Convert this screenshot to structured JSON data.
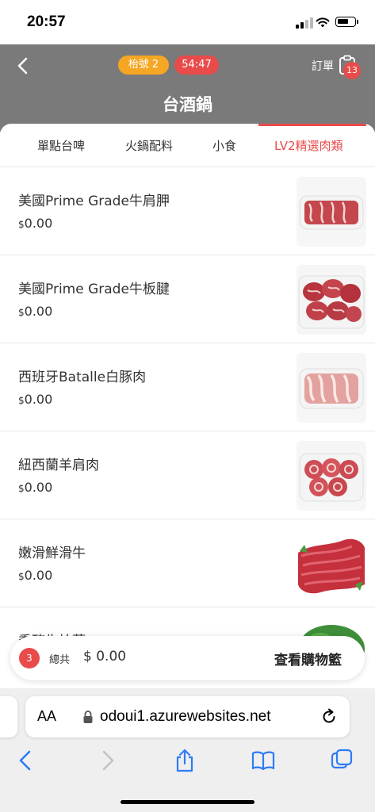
{
  "status_bar": {
    "time": "20:57"
  },
  "header": {
    "table_badge": "枱號 2",
    "timer_badge": "54:47",
    "order_label": "訂單",
    "order_count": "13",
    "store_title": "台酒鍋"
  },
  "tabs": [
    {
      "label": "單點台啤",
      "active": false
    },
    {
      "label": "火鍋配料",
      "active": false
    },
    {
      "label": "小食",
      "active": false
    },
    {
      "label": "LV2精選肉類",
      "active": true
    }
  ],
  "items": [
    {
      "name": "美國Prime Grade牛肩胛",
      "currency": "$",
      "price": "0.00",
      "image": "sliced-beef-image"
    },
    {
      "name": "美國Prime Grade牛板腱",
      "currency": "$",
      "price": "0.00",
      "image": "beef-rolls-image"
    },
    {
      "name": "西班牙Batalle白豚肉",
      "currency": "$",
      "price": "0.00",
      "image": "sliced-pork-image"
    },
    {
      "name": "紐西蘭羊肩肉",
      "currency": "$",
      "price": "0.00",
      "image": "lamb-rolls-image"
    },
    {
      "name": "嫩滑鮮滑牛",
      "currency": "$",
      "price": "0.00",
      "image": "shredded-beef-image"
    },
    {
      "name": "黍豬生柏葉",
      "currency": "$",
      "price": "",
      "image": "tripe-image"
    }
  ],
  "cart": {
    "count": "3",
    "total_label": "總共",
    "total": "$ 0.00",
    "view_label": "查看購物籃"
  },
  "browser": {
    "aa_label": "AA",
    "url": "odoui1.azurewebsites.net"
  },
  "colors": {
    "accent": "#e94b4b",
    "badge_orange": "#f5a623",
    "header_bg": "#7a7a7a"
  }
}
